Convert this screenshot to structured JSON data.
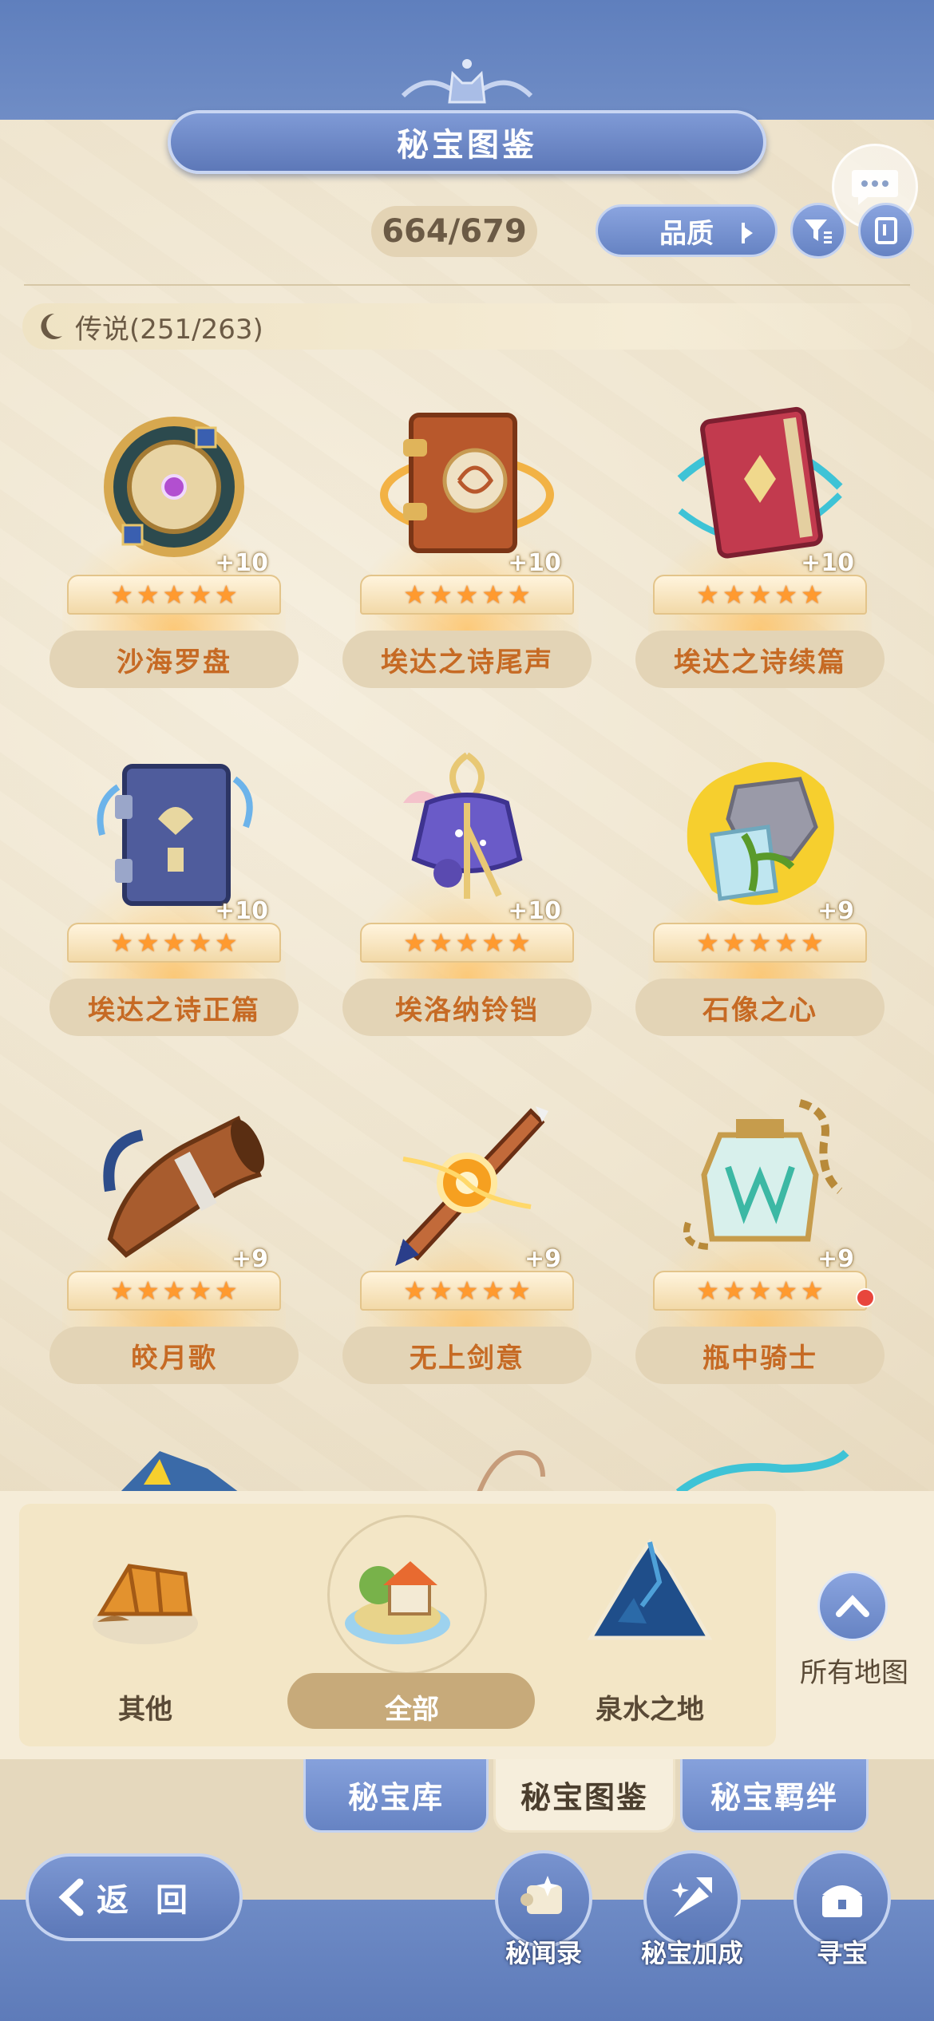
{
  "header": {
    "title": "秘宝图鉴"
  },
  "toolbar": {
    "count": "664/679",
    "quality_label": "品质"
  },
  "legend": {
    "label": "传说(251/263)"
  },
  "treasures": [
    {
      "name": "沙海罗盘",
      "plus": "+10",
      "stars": 5,
      "icon": "compass-icon"
    },
    {
      "name": "埃达之诗尾声",
      "plus": "+10",
      "stars": 5,
      "icon": "brown-book-icon"
    },
    {
      "name": "埃达之诗续篇",
      "plus": "+10",
      "stars": 5,
      "icon": "red-book-icon"
    },
    {
      "name": "埃达之诗正篇",
      "plus": "+10",
      "stars": 5,
      "icon": "blue-book-icon"
    },
    {
      "name": "埃洛纳铃铛",
      "plus": "+10",
      "stars": 5,
      "icon": "bell-icon"
    },
    {
      "name": "石像之心",
      "plus": "+9",
      "stars": 5,
      "icon": "stone-heart-icon"
    },
    {
      "name": "皎月歌",
      "plus": "+9",
      "stars": 5,
      "icon": "horn-icon"
    },
    {
      "name": "无上剑意",
      "plus": "+9",
      "stars": 5,
      "icon": "sword-icon"
    },
    {
      "name": "瓶中骑士",
      "plus": "+9",
      "stars": 5,
      "icon": "bottle-knight-icon",
      "notification": true
    }
  ],
  "regions": {
    "items": [
      {
        "label": "其他",
        "icon": "other-region-icon"
      },
      {
        "label": "全部",
        "icon": "all-region-icon",
        "active": true
      },
      {
        "label": "泉水之地",
        "icon": "mountain-region-icon"
      }
    ],
    "all_maps_label": "所有地图"
  },
  "tabs": {
    "vault": "秘宝库",
    "codex": "秘宝图鉴",
    "bond": "秘宝羁绊"
  },
  "footer": {
    "back_label": "返 回",
    "actions": [
      {
        "label": "秘闻录",
        "icon": "scroll-icon"
      },
      {
        "label": "秘宝加成",
        "icon": "boost-icon"
      },
      {
        "label": "寻宝",
        "icon": "treasure-hunt-icon"
      }
    ]
  },
  "colors": {
    "accent_blue": "#6683c3",
    "name_orange": "#c66a24",
    "star_orange": "#ff9a2f",
    "parchment": "#f3e6c6"
  }
}
